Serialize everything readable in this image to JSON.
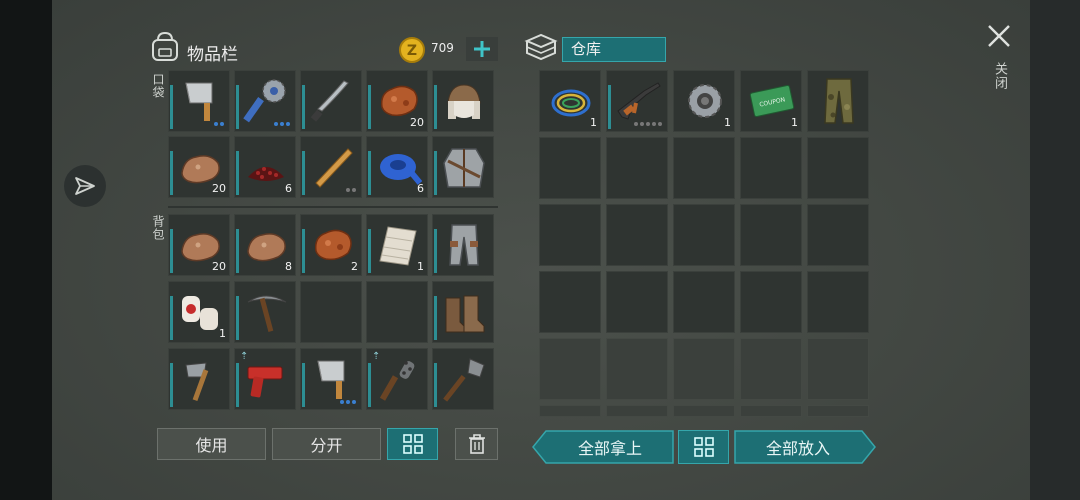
{
  "inventory": {
    "title": "物品栏",
    "coins": "709",
    "pocket_label": "口袋",
    "backpack_label": "背包",
    "pocket_slots": [
      {
        "icon": "cleaver-icon",
        "qty": "",
        "dots": 2,
        "dotColor": "blue"
      },
      {
        "icon": "saw-club-icon",
        "qty": "",
        "dots": 3,
        "dotColor": "blue"
      },
      {
        "icon": "machete-icon",
        "qty": "",
        "dots": 0
      },
      {
        "icon": "copper-ore-icon",
        "qty": "20",
        "dots": 0
      },
      {
        "icon": "trapper-hat-icon",
        "qty": "",
        "dots": 0
      },
      {
        "icon": "iron-ore-icon",
        "qty": "20",
        "dots": 0
      },
      {
        "icon": "berries-icon",
        "qty": "6",
        "dots": 0
      },
      {
        "icon": "baseball-bat-icon",
        "qty": "",
        "dots": 2,
        "dotColor": "grey"
      },
      {
        "icon": "duct-tape-icon",
        "qty": "6",
        "dots": 0
      },
      {
        "icon": "armor-jacket-icon",
        "qty": "",
        "dots": 0
      }
    ],
    "backpack_slots": [
      {
        "icon": "iron-ore-icon",
        "qty": "20"
      },
      {
        "icon": "iron-ore-icon",
        "qty": "8"
      },
      {
        "icon": "copper-ore-icon",
        "qty": "2"
      },
      {
        "icon": "cloth-icon",
        "qty": "1"
      },
      {
        "icon": "armor-pants-icon",
        "qty": ""
      },
      {
        "icon": "bandage-icon",
        "qty": "1"
      },
      {
        "icon": "pickaxe-icon",
        "qty": ""
      },
      {
        "icon": "empty",
        "qty": ""
      },
      {
        "icon": "empty",
        "qty": ""
      },
      {
        "icon": "boots-icon",
        "qty": ""
      },
      {
        "icon": "hatchet-icon",
        "qty": ""
      },
      {
        "icon": "flare-gun-icon",
        "qty": "",
        "tag": "⇡"
      },
      {
        "icon": "cleaver-icon",
        "qty": "",
        "dots": 3
      },
      {
        "icon": "spiked-club-icon",
        "qty": "",
        "tag": "⇡"
      },
      {
        "icon": "shovel-icon",
        "qty": ""
      }
    ],
    "use_label": "使用",
    "split_label": "分开"
  },
  "storage": {
    "title": "仓库",
    "items": [
      {
        "icon": "cable-icon",
        "qty": "1"
      },
      {
        "icon": "assault-rifle-icon",
        "qty": "",
        "dots": 5
      },
      {
        "icon": "gear-part-icon",
        "qty": "1"
      },
      {
        "icon": "ration-coupon-icon",
        "qty": "1",
        "text": "RATION COUPON"
      },
      {
        "icon": "camo-pants-icon",
        "qty": ""
      }
    ],
    "take_all_label": "全部拿上",
    "put_all_label": "全部放入"
  },
  "close_label": "关闭",
  "colors": {
    "accent": "#1d6f74",
    "accent_border": "#35a6ab",
    "durability": "#2d8e93"
  }
}
